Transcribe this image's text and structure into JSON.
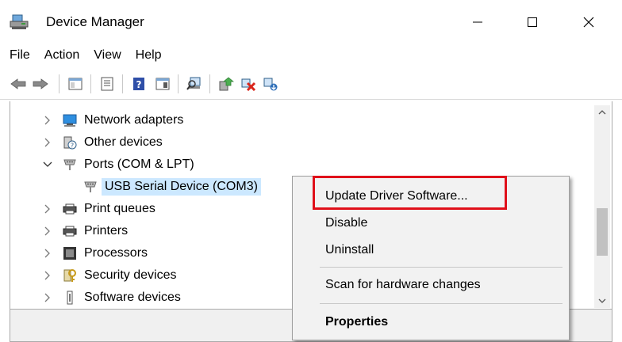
{
  "window": {
    "title": "Device Manager"
  },
  "menu": {
    "items": [
      "File",
      "Action",
      "View",
      "Help"
    ]
  },
  "toolbar": {
    "buttons": [
      "back-arrow-icon",
      "forward-arrow-icon",
      "show-hide-tree-icon",
      "properties-icon",
      "help-icon",
      "action-pane-icon",
      "scan-hardware-icon",
      "update-driver-icon",
      "uninstall-device-icon",
      "add-legacy-hardware-icon"
    ]
  },
  "tree": {
    "items": [
      {
        "label": "Network adapters",
        "icon": "network-adapter-icon",
        "expanded": false
      },
      {
        "label": "Other devices",
        "icon": "unknown-device-icon",
        "expanded": false
      },
      {
        "label": "Ports (COM & LPT)",
        "icon": "port-icon",
        "expanded": true
      },
      {
        "label": "USB Serial Device (COM3)",
        "icon": "port-icon",
        "child": true,
        "selected": true
      },
      {
        "label": "Print queues",
        "icon": "printer-icon",
        "expanded": false
      },
      {
        "label": "Printers",
        "icon": "printer-icon",
        "expanded": false
      },
      {
        "label": "Processors",
        "icon": "processor-icon",
        "expanded": false
      },
      {
        "label": "Security devices",
        "icon": "key-icon",
        "expanded": false
      },
      {
        "label": "Software devices",
        "icon": "software-device-icon",
        "expanded": false
      }
    ]
  },
  "context_menu": {
    "update_driver": "Update Driver Software...",
    "disable": "Disable",
    "uninstall": "Uninstall",
    "scan": "Scan for hardware changes",
    "properties": "Properties"
  },
  "colors": {
    "selection": "#cce8ff",
    "highlight_box": "#e0101a",
    "menu_bg": "#f2f2f2"
  }
}
